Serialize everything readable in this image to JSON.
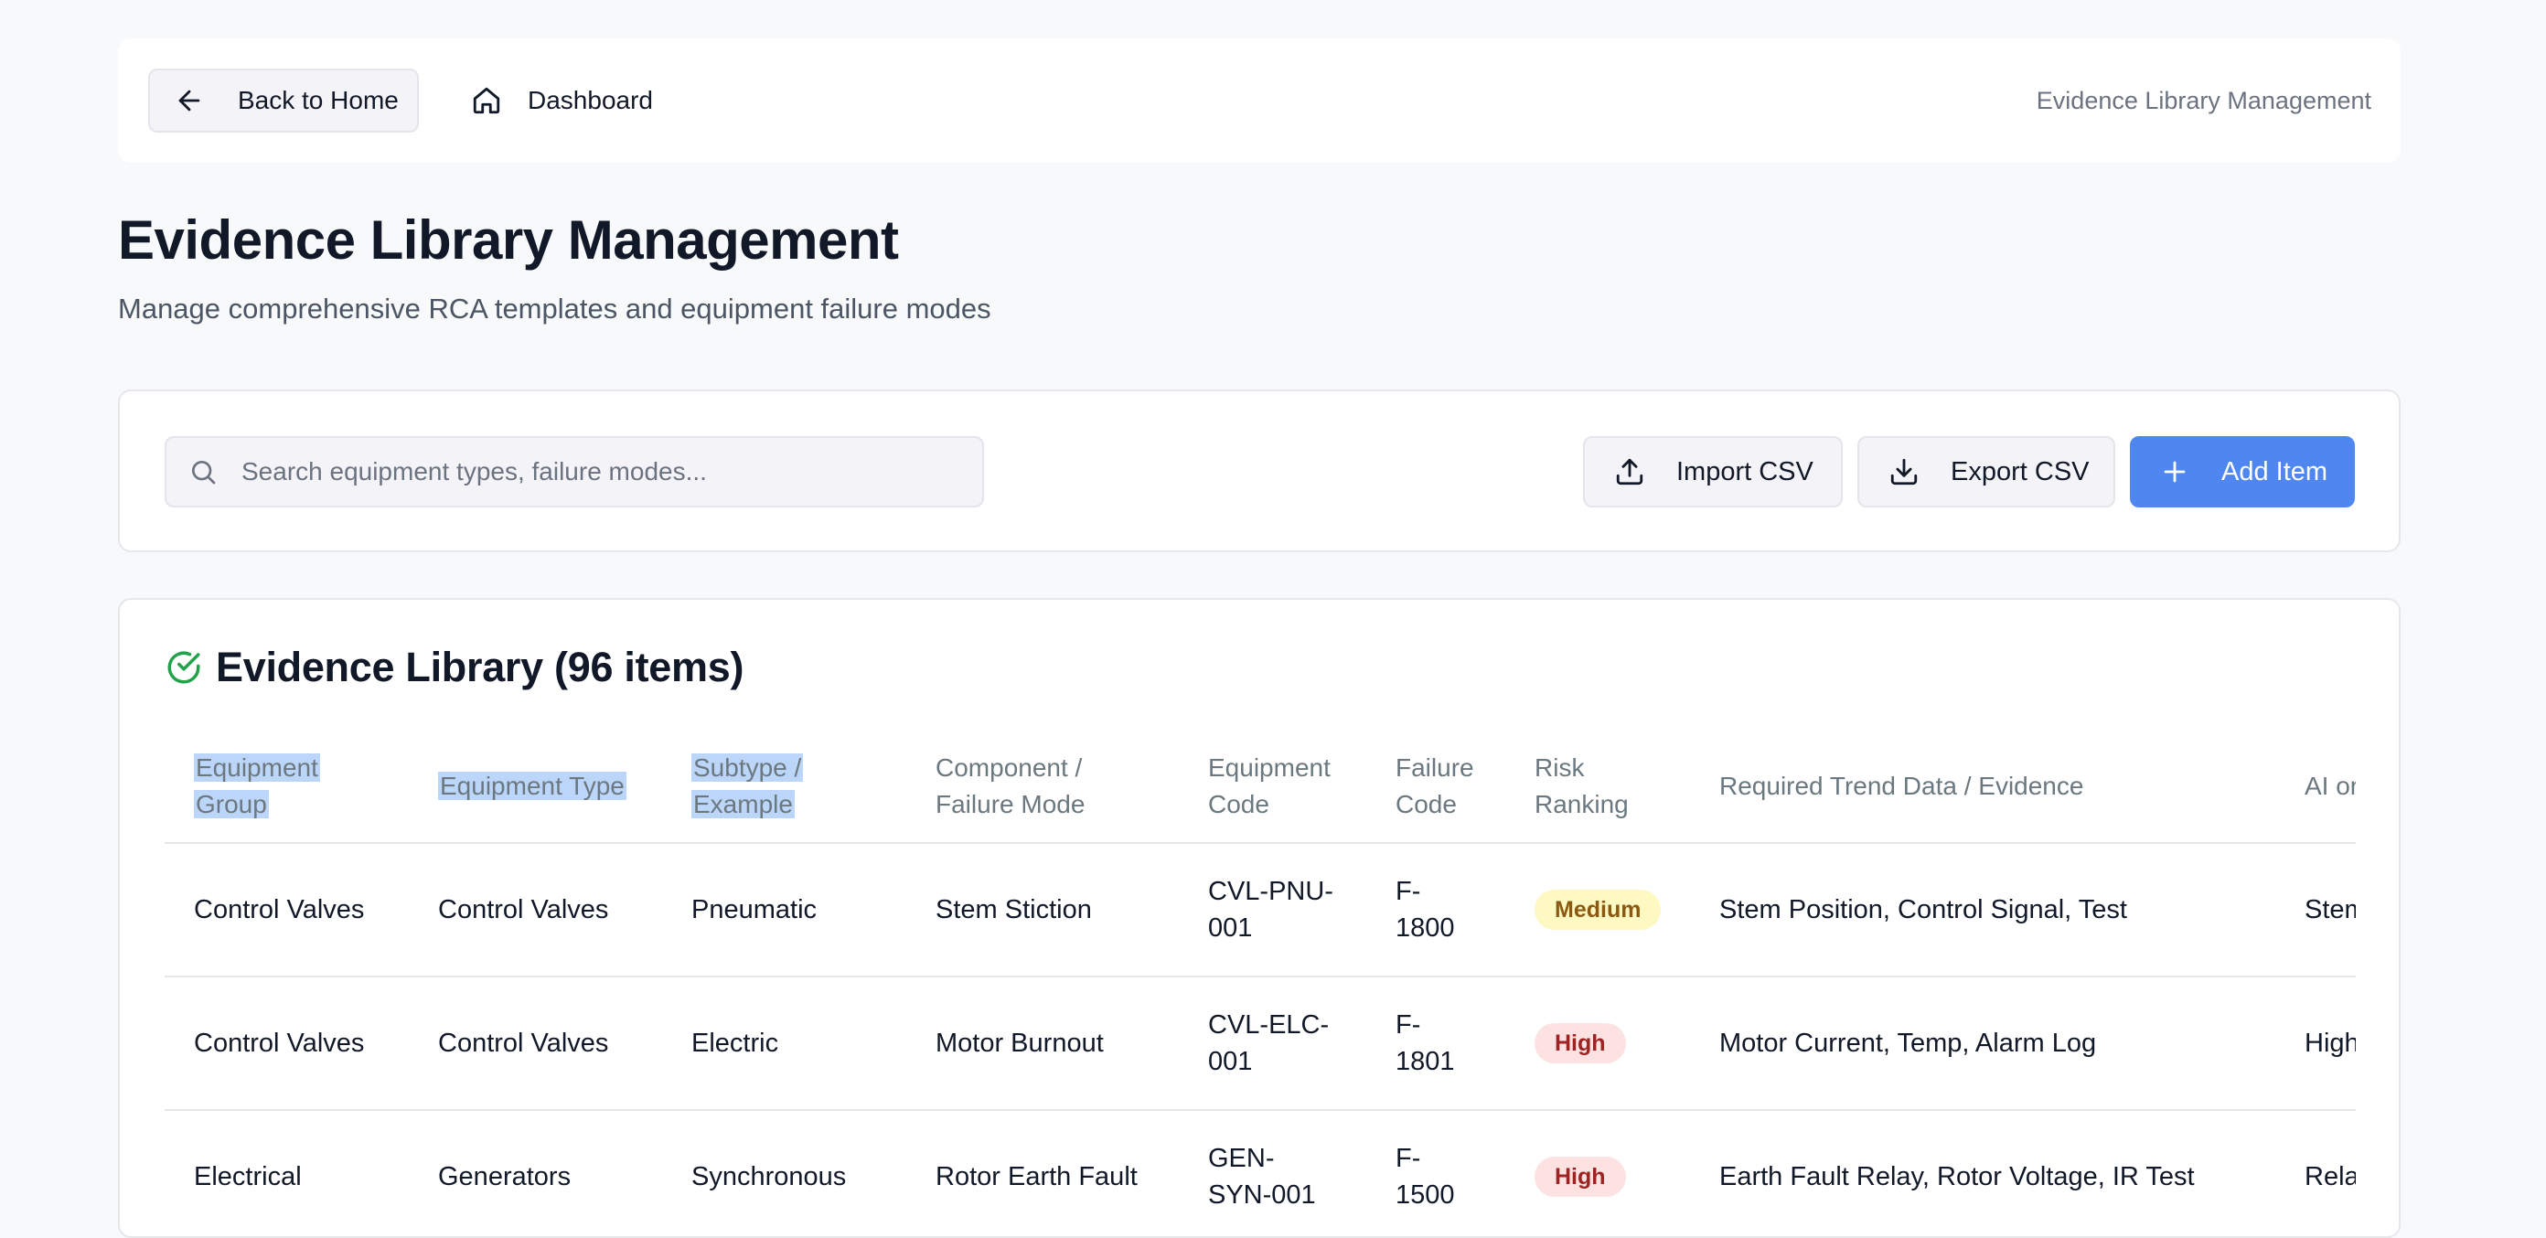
{
  "topbar": {
    "back_label": "Back to Home",
    "dashboard_label": "Dashboard",
    "breadcrumb": "Evidence Library Management"
  },
  "page": {
    "title": "Evidence Library Management",
    "subtitle": "Manage comprehensive RCA templates and equipment failure modes"
  },
  "toolbar": {
    "search_placeholder": "Search equipment types, failure modes...",
    "import_label": "Import CSV",
    "export_label": "Export CSV",
    "add_label": "Add Item",
    "accent": "#4f86f0"
  },
  "library": {
    "title": "Evidence Library (96 items)",
    "columns": [
      "Equipment Group",
      "Equipment Type",
      "Subtype / Example",
      "Component / Failure Mode",
      "Equipment Code",
      "Failure Code",
      "Risk Ranking",
      "Required Trend Data / Evidence",
      "AI or"
    ],
    "selected_columns": [
      0,
      1,
      2
    ],
    "rows": [
      {
        "group": "Control Valves",
        "type": "Control Valves",
        "subtype": "Pneumatic",
        "failure_mode": "Stem Stiction",
        "equipment_code": "CVL-PNU-001",
        "failure_code": "F-1800",
        "risk": "Medium",
        "evidence": "Stem Position, Control Signal, Test",
        "ai": "Stem"
      },
      {
        "group": "Control Valves",
        "type": "Control Valves",
        "subtype": "Electric",
        "failure_mode": "Motor Burnout",
        "equipment_code": "CVL-ELC-001",
        "failure_code": "F-1801",
        "risk": "High",
        "evidence": "Motor Current, Temp, Alarm Log",
        "ai": "High"
      },
      {
        "group": "Electrical",
        "type": "Generators",
        "subtype": "Synchronous",
        "failure_mode": "Rotor Earth Fault",
        "equipment_code": "GEN-SYN-001",
        "failure_code": "F-1500",
        "risk": "High",
        "evidence": "Earth Fault Relay, Rotor Voltage, IR Test",
        "ai": "Rela"
      }
    ]
  }
}
